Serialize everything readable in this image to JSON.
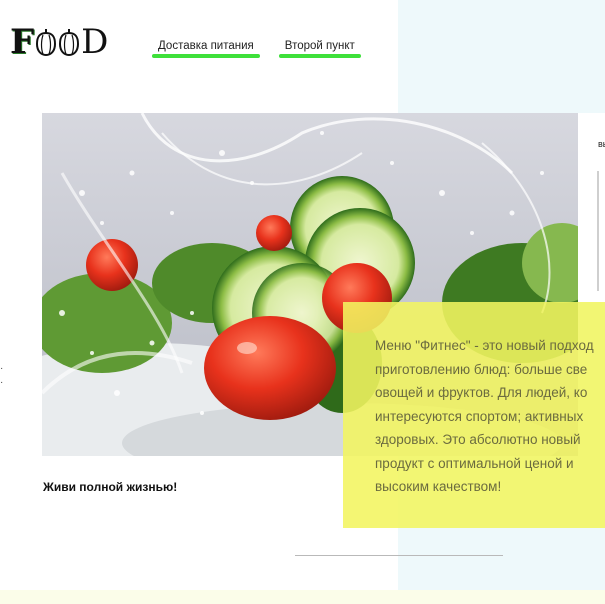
{
  "brand": {
    "logo_first": "F",
    "logo_last": "D"
  },
  "nav": {
    "items": [
      {
        "label": "Доставка питания"
      },
      {
        "label": "Второй пункт"
      }
    ]
  },
  "side_card": {
    "partial_text": "вы"
  },
  "promo": {
    "lines": [
      "Меню \"Фитнес\" - это новый подход",
      "приготовлению блюд: больше све",
      "овощей и фруктов. Для людей, ко",
      "интересуются спортом; активных",
      "здоровых. Это абсолютно новый",
      "продукт с оптимальной ценой и",
      "высоким качеством!"
    ]
  },
  "tagline": "Живи полной жизнью!",
  "colors": {
    "accent_green": "#3ee03a",
    "promo_yellow": "#f2f560",
    "panel_blue": "#eef9fb"
  }
}
